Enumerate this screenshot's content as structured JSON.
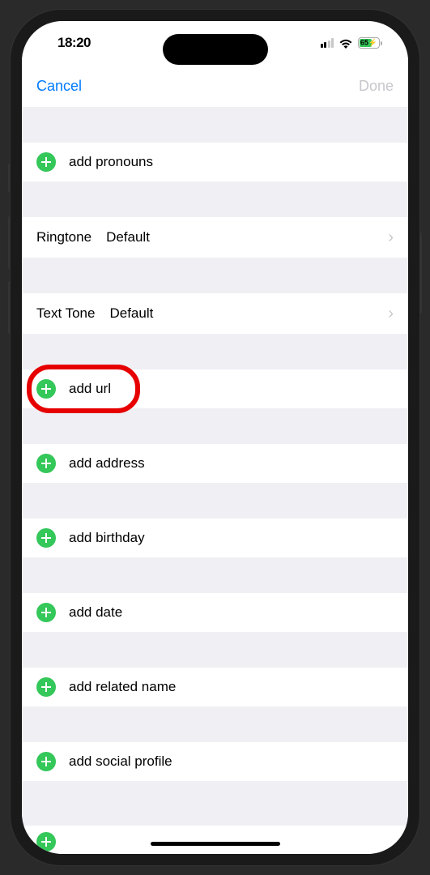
{
  "status": {
    "time": "18:20",
    "battery": "65"
  },
  "nav": {
    "cancel": "Cancel",
    "done": "Done"
  },
  "rows": {
    "pronouns": "add pronouns",
    "ringtone_key": "Ringtone",
    "ringtone_value": "Default",
    "texttone_key": "Text Tone",
    "texttone_value": "Default",
    "url": "add url",
    "address": "add address",
    "birthday": "add birthday",
    "date": "add date",
    "related": "add related name",
    "social": "add social profile"
  }
}
